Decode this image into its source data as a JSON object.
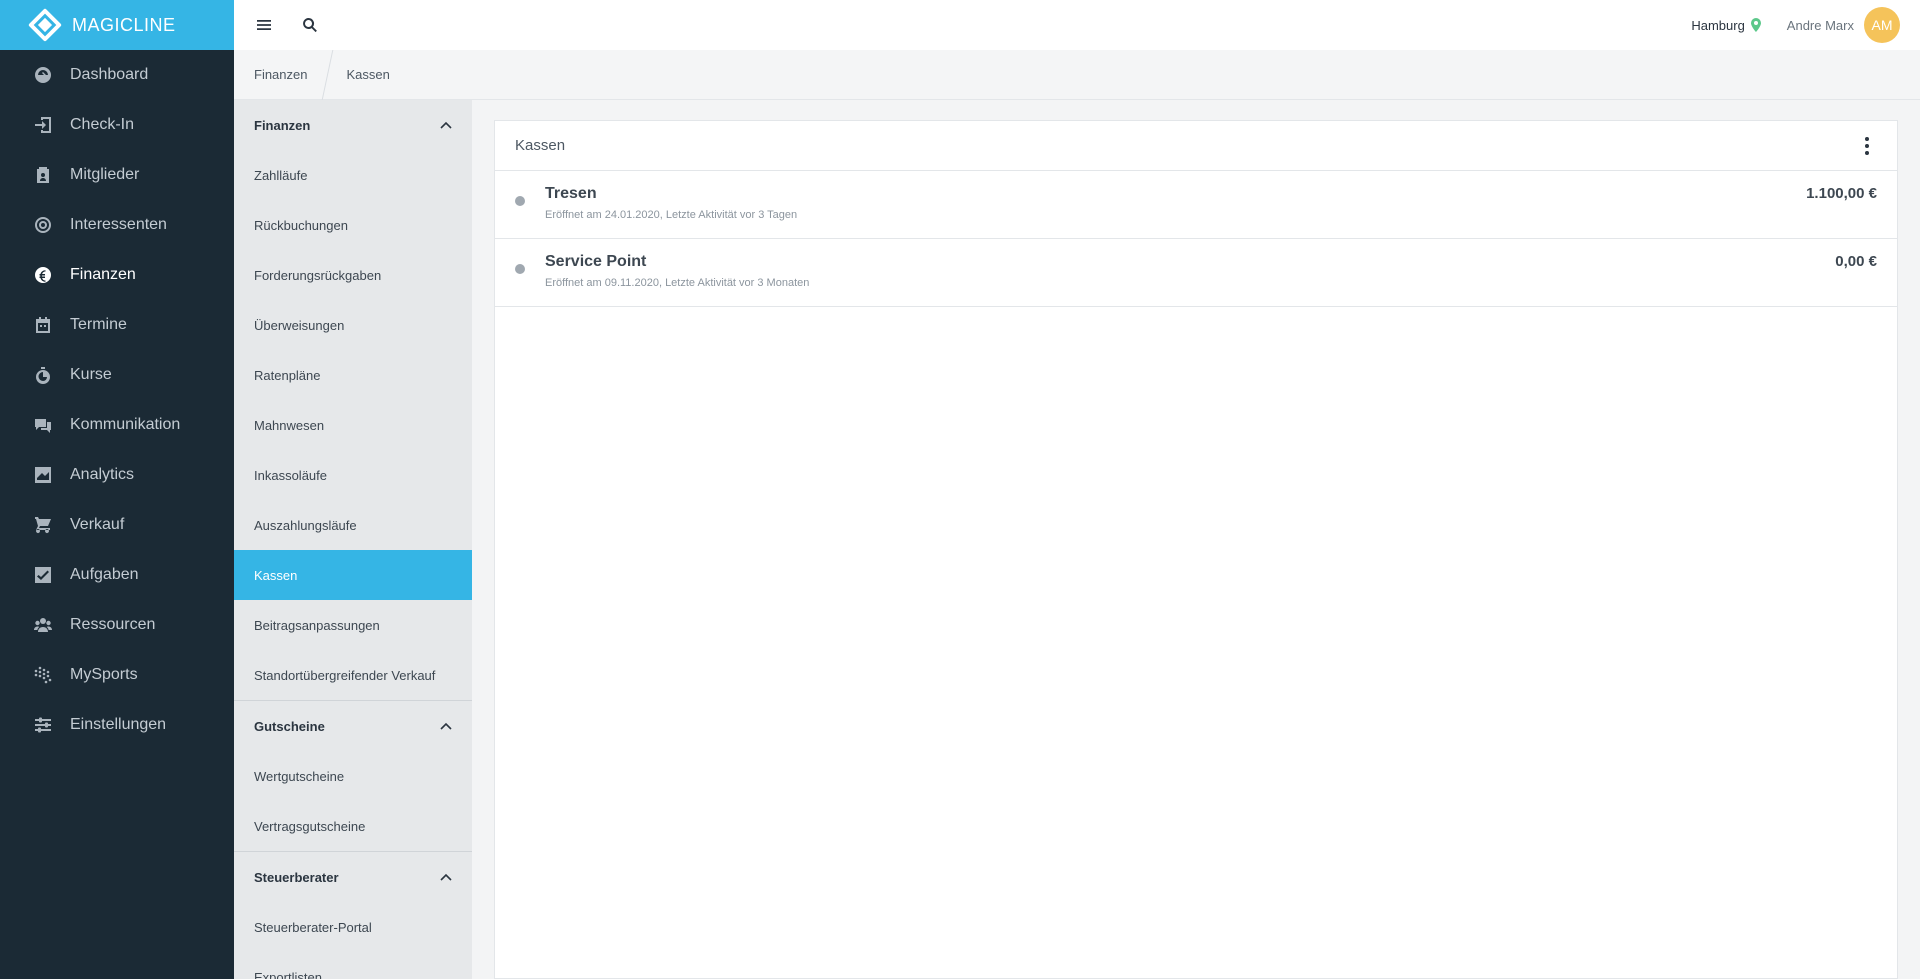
{
  "brand": {
    "name": "MAGICLINE"
  },
  "sidebar": {
    "items": [
      {
        "label": "Dashboard",
        "icon": "dashboard-icon"
      },
      {
        "label": "Check-In",
        "icon": "check-in-icon"
      },
      {
        "label": "Mitglieder",
        "icon": "members-icon"
      },
      {
        "label": "Interessenten",
        "icon": "prospects-icon"
      },
      {
        "label": "Finanzen",
        "icon": "euro-icon",
        "active": true
      },
      {
        "label": "Termine",
        "icon": "calendar-icon"
      },
      {
        "label": "Kurse",
        "icon": "stopwatch-icon"
      },
      {
        "label": "Kommunikation",
        "icon": "chat-icon"
      },
      {
        "label": "Analytics",
        "icon": "chart-icon"
      },
      {
        "label": "Verkauf",
        "icon": "cart-icon"
      },
      {
        "label": "Aufgaben",
        "icon": "checkbox-icon"
      },
      {
        "label": "Ressourcen",
        "icon": "group-icon"
      },
      {
        "label": "MySports",
        "icon": "dots-grid-icon"
      },
      {
        "label": "Einstellungen",
        "icon": "sliders-icon"
      }
    ]
  },
  "topbar": {
    "location": "Hamburg",
    "user_name": "Andre Marx",
    "avatar_initials": "AM"
  },
  "breadcrumb": [
    "Finanzen",
    "Kassen"
  ],
  "subnav": {
    "sections": [
      {
        "title": "Finanzen",
        "items": [
          "Zahlläufe",
          "Rückbuchungen",
          "Forderungsrückgaben",
          "Überweisungen",
          "Ratenpläne",
          "Mahnwesen",
          "Inkassoläufe",
          "Auszahlungsläufe",
          "Kassen",
          "Beitragsanpassungen",
          "Standortübergreifender Verkauf"
        ]
      },
      {
        "title": "Gutscheine",
        "items": [
          "Wertgutscheine",
          "Vertragsgutscheine"
        ]
      },
      {
        "title": "Steuerberater",
        "items": [
          "Steuerberater-Portal",
          "Exportlisten"
        ]
      }
    ],
    "active_item": "Kassen"
  },
  "panel": {
    "title": "Kassen",
    "rows": [
      {
        "name": "Tresen",
        "meta": "Eröffnet am 24.01.2020, Letzte Aktivität vor 3 Tagen",
        "amount": "1.100,00 €"
      },
      {
        "name": "Service Point",
        "meta": "Eröffnet am 09.11.2020, Letzte Aktivität vor 3 Monaten",
        "amount": "0,00 €"
      }
    ]
  },
  "colors": {
    "brand": "#35b5e5",
    "sidebar_bg": "#1b2a35",
    "avatar": "#f5c35a",
    "location_pin": "#5cc88a"
  }
}
